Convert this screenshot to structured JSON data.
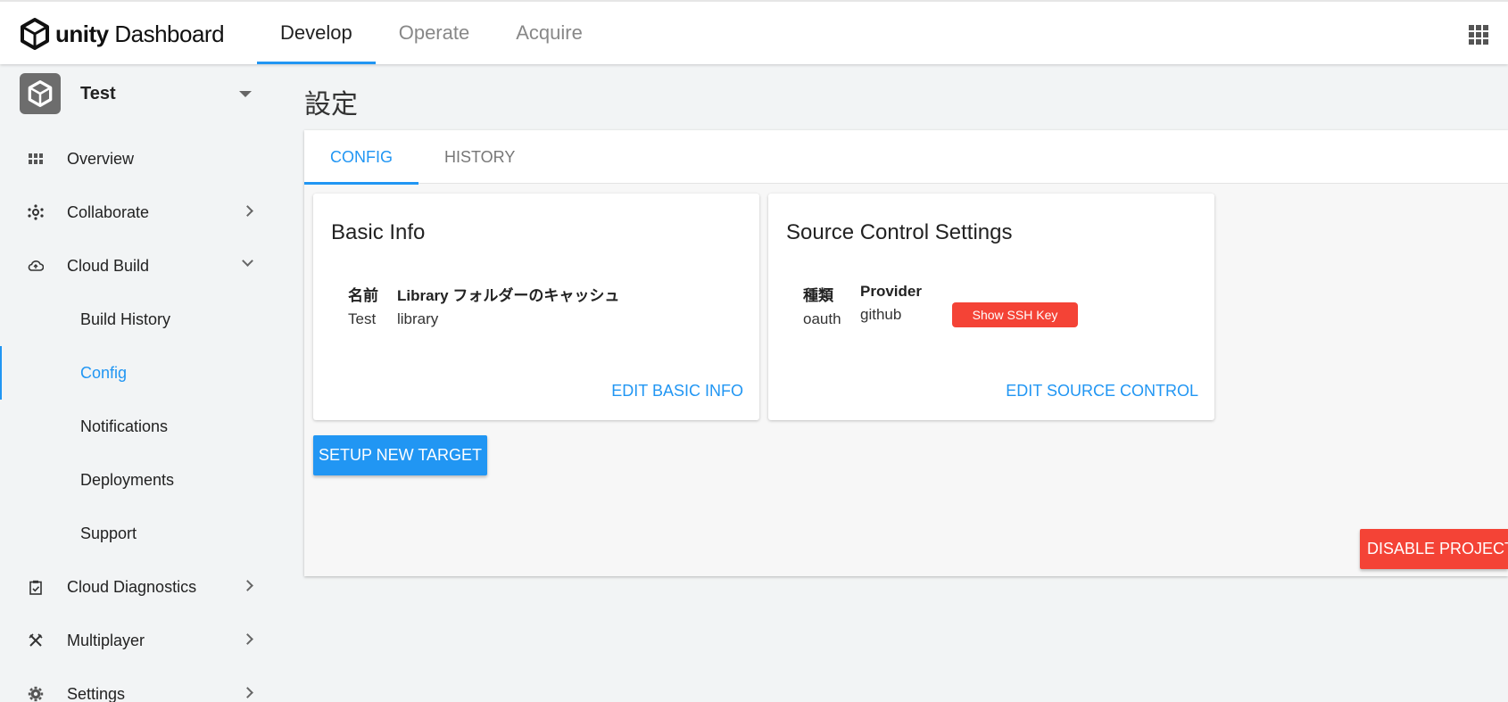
{
  "header": {
    "logo_brand": "unity",
    "logo_product": "Dashboard",
    "nav_tabs": [
      {
        "label": "Develop",
        "active": true
      },
      {
        "label": "Operate",
        "active": false
      },
      {
        "label": "Acquire",
        "active": false
      }
    ],
    "apps_icon": "grid-icon"
  },
  "sidebar": {
    "project_name": "Test",
    "items": [
      {
        "label": "Overview",
        "icon": "grid-icon"
      },
      {
        "label": "Collaborate",
        "icon": "collaborate-icon"
      },
      {
        "label": "Cloud Build",
        "icon": "cloud-icon"
      },
      {
        "label": "Build History"
      },
      {
        "label": "Config",
        "active": true
      },
      {
        "label": "Notifications"
      },
      {
        "label": "Deployments"
      },
      {
        "label": "Support"
      },
      {
        "label": "Cloud Diagnostics",
        "icon": "clipboard-icon"
      },
      {
        "label": "Multiplayer",
        "icon": "swords-icon"
      },
      {
        "label": "Settings",
        "icon": "gear-icon"
      }
    ]
  },
  "main": {
    "title": "設定",
    "tabs": [
      {
        "label": "CONFIG",
        "active": true
      },
      {
        "label": "HISTORY",
        "active": false
      }
    ],
    "basic_info": {
      "title": "Basic Info",
      "col1_header": "名前",
      "col1_value": "Test",
      "col2_header": "Library フォルダーのキャッシュ",
      "col2_value": "library",
      "action": "EDIT BASIC INFO"
    },
    "source_control": {
      "title": "Source Control Settings",
      "col1_header": "種類",
      "col1_value": "oauth",
      "col2_header": "Provider",
      "col2_value": "github",
      "ssh_button": "Show SSH Key",
      "action": "EDIT SOURCE CONTROL"
    },
    "setup_button": "SETUP NEW TARGET",
    "disable_button": "DISABLE PROJECT"
  },
  "colors": {
    "accent": "#2196f3",
    "danger": "#f44336"
  }
}
